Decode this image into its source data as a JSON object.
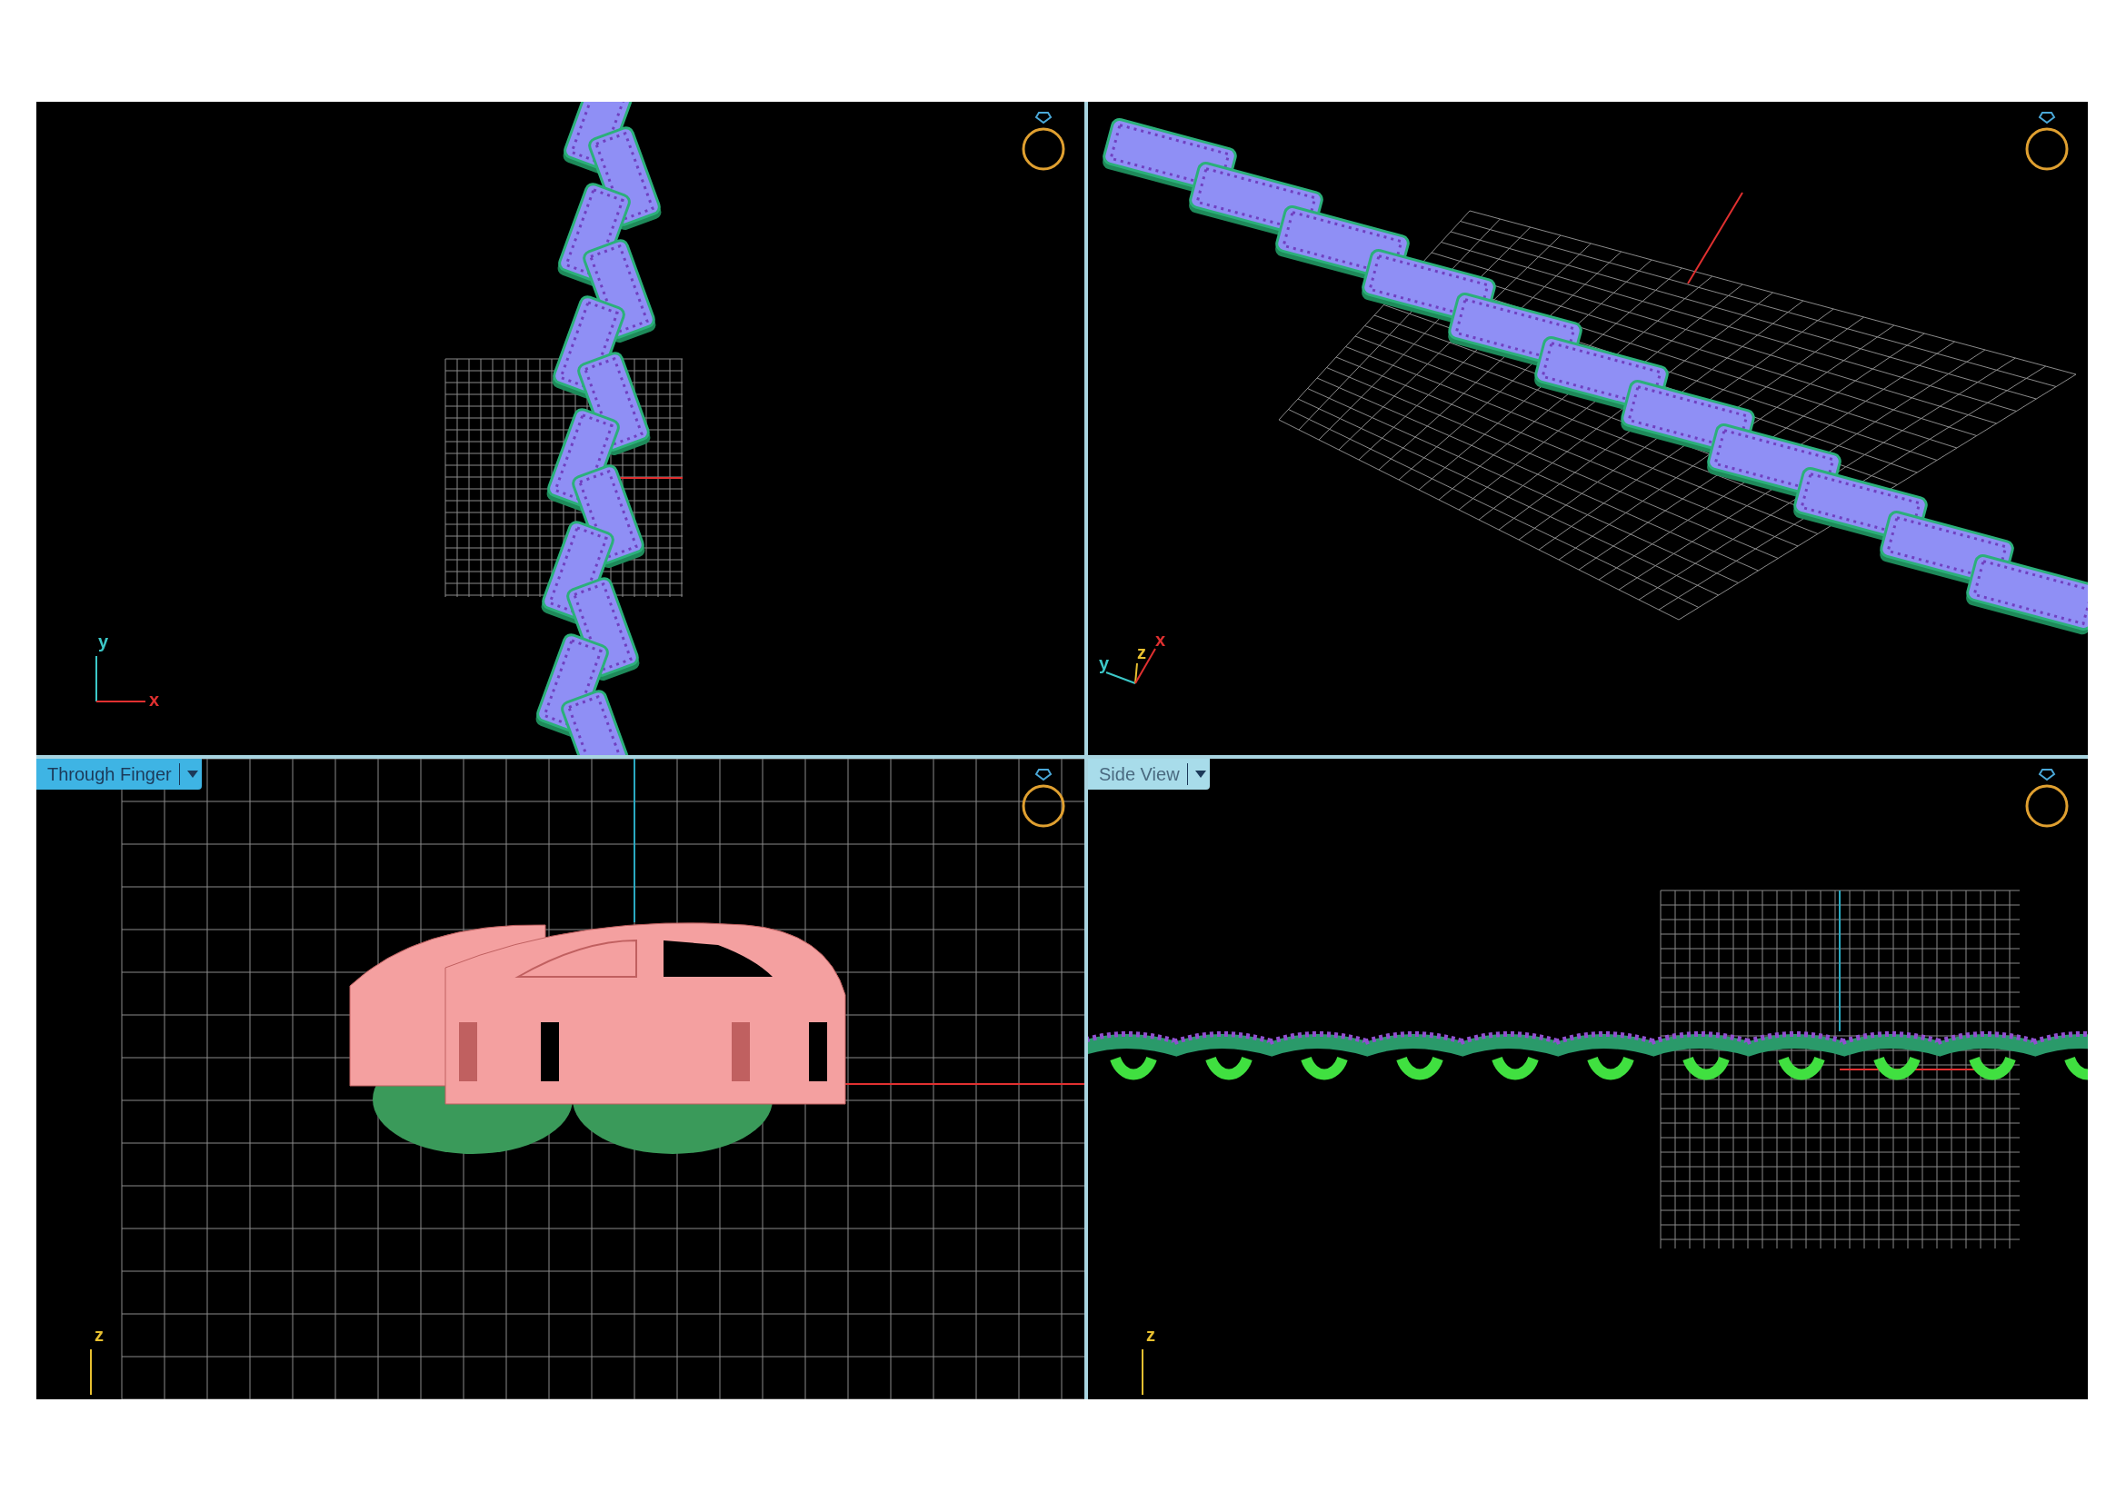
{
  "viewports": [
    {
      "kind": "top",
      "axes": [
        "y",
        "x"
      ]
    },
    {
      "kind": "perspective",
      "axes": [
        "y",
        "z",
        "x"
      ]
    },
    {
      "kind": "front",
      "view_menu": {
        "label": "Through Finger",
        "selected": true
      },
      "axes": [
        "z"
      ]
    },
    {
      "kind": "side",
      "view_menu": {
        "label": "Side View",
        "selected": false
      },
      "axes": [
        "z"
      ]
    }
  ]
}
